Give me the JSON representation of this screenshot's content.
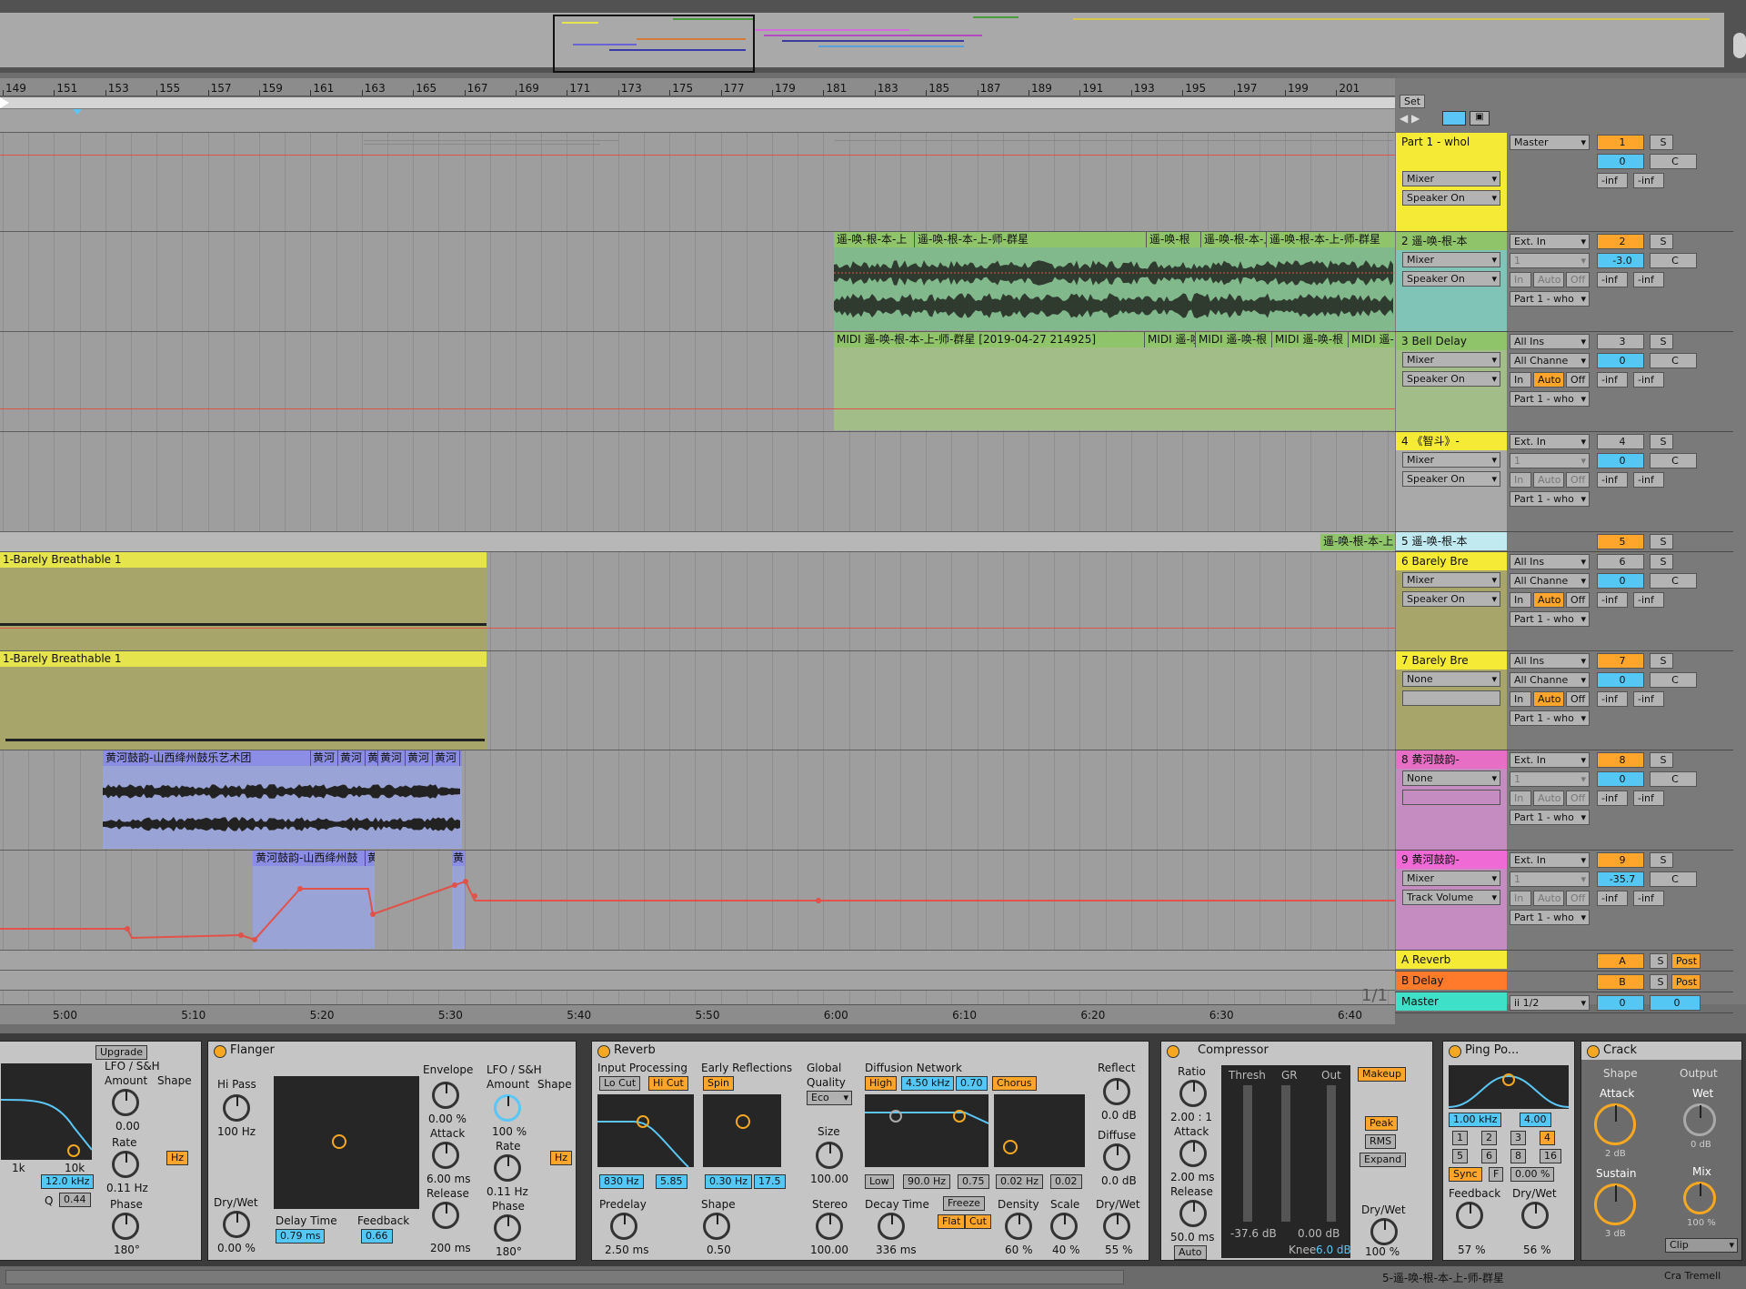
{
  "ruler": {
    "bars": [
      "149",
      "151",
      "153",
      "155",
      "157",
      "159",
      "161",
      "163",
      "165",
      "167",
      "169",
      "171",
      "173",
      "175",
      "177",
      "179",
      "181",
      "183",
      "185",
      "187",
      "189",
      "191",
      "193",
      "195",
      "197",
      "199",
      "201"
    ]
  },
  "time_ruler": {
    "times": [
      "5:00",
      "5:10",
      "5:20",
      "5:30",
      "5:40",
      "5:50",
      "6:00",
      "6:10",
      "6:20",
      "6:30",
      "6:40"
    ]
  },
  "set_label": "Set",
  "page_count": "1/1",
  "clips": {
    "audio2": [
      "遥-唤-根-本-上",
      "遥-唤-根-本-上-师-群星",
      "遥-唤-根",
      "遥-唤-根-本-上",
      "遥-唤-根-本-上-师-群星"
    ],
    "midi3": [
      "MIDI 遥-唤-根-本-上-师-群星 [2019-04-27 214925]",
      "MIDI 遥-唤",
      "MIDI 遥-唤-根",
      "MIDI 遥-唤-根",
      "MIDI 遥-"
    ],
    "t5": "遥-唤-根-本-上",
    "t6": "1-Barely Breathable 1",
    "t7": "1-Barely Breathable 1",
    "t8": [
      "黄河鼓韵-山西绛州鼓乐艺术团",
      "黄河",
      "黄河",
      "黄",
      "黄河",
      "黄河",
      "黄河",
      "黄河"
    ],
    "t9": [
      "黄河鼓韵-山西绛州鼓",
      "黄",
      "黄"
    ]
  },
  "tracks": [
    {
      "name": "Part 1 - whol",
      "io": "Master",
      "num": "1",
      "vol": "0",
      "pan": "C",
      "a": "-inf",
      "b": "-inf",
      "mixer": "Mixer",
      "param": "Speaker On"
    },
    {
      "name": "2 遥-唤-根-本",
      "io": "Ext. In",
      "ch": "1",
      "num": "2",
      "vol": "-3.0",
      "pan": "C",
      "a": "-inf",
      "b": "-inf",
      "mixer": "Mixer",
      "param": "Speaker On",
      "out": "Part 1 - who"
    },
    {
      "name": "3 Bell Delay",
      "io": "All Ins",
      "ch": "All Channe",
      "num": "3",
      "vol": "0",
      "pan": "C",
      "a": "-inf",
      "b": "-inf",
      "mixer": "Mixer",
      "param": "Speaker On",
      "out": "Part 1 - who"
    },
    {
      "name": "4 《智斗》-",
      "io": "Ext. In",
      "ch": "1",
      "num": "4",
      "vol": "0",
      "pan": "C",
      "a": "-inf",
      "b": "-inf",
      "mixer": "Mixer",
      "param": "Speaker On",
      "out": "Part 1 - who"
    },
    {
      "name": "5 遥-唤-根-本",
      "num": "5"
    },
    {
      "name": "6 Barely Bre",
      "io": "All Ins",
      "ch": "All Channe",
      "num": "6",
      "vol": "0",
      "pan": "C",
      "a": "-inf",
      "b": "-inf",
      "mixer": "Mixer",
      "param": "Speaker On",
      "out": "Part 1 - who"
    },
    {
      "name": "7 Barely Bre",
      "io": "All Ins",
      "ch": "All Channe",
      "num": "7",
      "vol": "0",
      "pan": "C",
      "a": "-inf",
      "b": "-inf",
      "mixer": "None",
      "param": "",
      "out": "Part 1 - who"
    },
    {
      "name": "8 黄河鼓韵-",
      "io": "Ext. In",
      "ch": "1",
      "num": "8",
      "vol": "0",
      "pan": "C",
      "a": "-inf",
      "b": "-inf",
      "mixer": "None",
      "param": "",
      "out": "Part 1 - who"
    },
    {
      "name": "9 黄河鼓韵-",
      "io": "Ext. In",
      "ch": "1",
      "num": "9",
      "vol": "-35.7",
      "pan": "C",
      "a": "-inf",
      "b": "-inf",
      "mixer": "Mixer",
      "param": "Track Volume",
      "out": "Part 1 - who"
    }
  ],
  "returns": [
    {
      "name": "A Reverb",
      "num": "A",
      "s": "S",
      "post": "Post"
    },
    {
      "name": "B Delay",
      "num": "B",
      "s": "S",
      "post": "Post"
    },
    {
      "name": "Master",
      "io": "ii 1/2",
      "num": "0",
      "vol": "0"
    }
  ],
  "routing_labels": {
    "in": "In",
    "auto": "Auto",
    "off": "Off",
    "s": "S"
  },
  "devices": {
    "eq": {
      "upgrade": "Upgrade",
      "freq": "12.0 kHz",
      "q_label": "Q",
      "q": "0.44",
      "x1": "1k",
      "x2": "10k"
    },
    "lfo1": {
      "title": "LFO / S&H",
      "amount": "Amount",
      "shape": "Shape",
      "amount_val": "0.00",
      "rate": "Rate",
      "rate_val": "0.11 Hz",
      "phase": "Phase",
      "phase_val": "180°",
      "hz": "Hz"
    },
    "flanger": {
      "title": "Flanger",
      "hipass": "Hi Pass",
      "hipass_val": "100 Hz",
      "drywet": "Dry/Wet",
      "drywet_val": "0.00 %",
      "delay": "Delay Time",
      "delay_val": "0.79 ms",
      "feedback": "Feedback",
      "feedback_val": "0.66",
      "envelope": "Envelope",
      "env_val": "0.00 %",
      "attack": "Attack",
      "attack_val": "6.00 ms",
      "release": "Release",
      "release_val": "200 ms",
      "lfo": "LFO / S&H",
      "amount": "Amount",
      "amount_val": "100 %",
      "shape": "Shape",
      "rate": "Rate",
      "rate_val": "0.11 Hz",
      "phase": "Phase",
      "phase_val": "180°",
      "hz": "Hz"
    },
    "reverb": {
      "title": "Reverb",
      "input": "Input Processing",
      "locut": "Lo Cut",
      "hicut": "Hi Cut",
      "in_freq": "830 Hz",
      "in_q": "5.85",
      "early": "Early Reflections",
      "spin": "Spin",
      "er_freq": "0.30 Hz",
      "er_amt": "17.5",
      "global": "Global",
      "quality": "Quality",
      "eco": "Eco",
      "size": "Size",
      "size_val": "100.00",
      "diff": "Diffusion Network",
      "high": "High",
      "hfreq": "4.50 kHz",
      "hval": "0.70",
      "chorus": "Chorus",
      "low": "Low",
      "lfreq": "90.0 Hz",
      "lval": "0.75",
      "cfreq": "0.02 Hz",
      "cval": "0.02",
      "reflect": "Reflect",
      "reflect_val": "0.0 dB",
      "diffuse": "Diffuse",
      "diffuse_val": "0.0 dB",
      "predelay": "Predelay",
      "predelay_val": "2.50 ms",
      "shape": "Shape",
      "shape_val": "0.50",
      "stereo": "Stereo",
      "stereo_val": "100.00",
      "decay": "Decay Time",
      "decay_val": "336 ms",
      "freeze": "Freeze",
      "flat": "Flat",
      "cut": "Cut",
      "density": "Density",
      "density_val": "60 %",
      "scale": "Scale",
      "scale_val": "40 %",
      "drywet": "Dry/Wet",
      "drywet_val": "55 %"
    },
    "comp": {
      "title": "Compressor",
      "ratio": "Ratio",
      "ratio_val": "2.00 : 1",
      "attack": "Attack",
      "attack_val": "2.00 ms",
      "release": "Release",
      "release_val": "50.0 ms",
      "auto": "Auto",
      "thresh": "Thresh",
      "gr": "GR",
      "out": "Out",
      "thresh_val": "-37.6 dB",
      "out_val": "0.00 dB",
      "knee": "Knee",
      "knee_val": "6.0 dB",
      "makeup": "Makeup",
      "peak": "Peak",
      "rms": "RMS",
      "expand": "Expand",
      "drywet": "Dry/Wet",
      "drywet_val": "100 %"
    },
    "ping": {
      "title": "Ping Po...",
      "freq": "1.00 kHz",
      "q": "4.00",
      "nums": [
        "1",
        "2",
        "3",
        "4",
        "5",
        "6",
        "8",
        "16"
      ],
      "sync": "Sync",
      "f": "F",
      "pct": "0.00 %",
      "feedback": "Feedback",
      "feedback_val": "57 %",
      "drywet": "Dry/Wet",
      "drywet_val": "56 %"
    },
    "crack": {
      "title": "Crack",
      "shape": "Shape",
      "output": "Output",
      "attack": "Attack",
      "attack_val": "2 dB",
      "wet": "Wet",
      "wet_val": "0 dB",
      "sustain": "Sustain",
      "sustain_val": "3 dB",
      "mix": "Mix",
      "mix_val": "100 %",
      "clip": "Clip"
    }
  },
  "status": {
    "clip_name": "5-遥-唤-根-本-上-师-群星",
    "device": "Cra Tremell"
  },
  "colors": {
    "yellow": "#f5ea35",
    "green": "#8fc46a",
    "teal": "#7fc4b6",
    "pink": "#e66ec4",
    "magenta": "#f06ad6",
    "orange": "#ffa52b",
    "blue": "#54c7f5",
    "red": "#e0524a"
  }
}
